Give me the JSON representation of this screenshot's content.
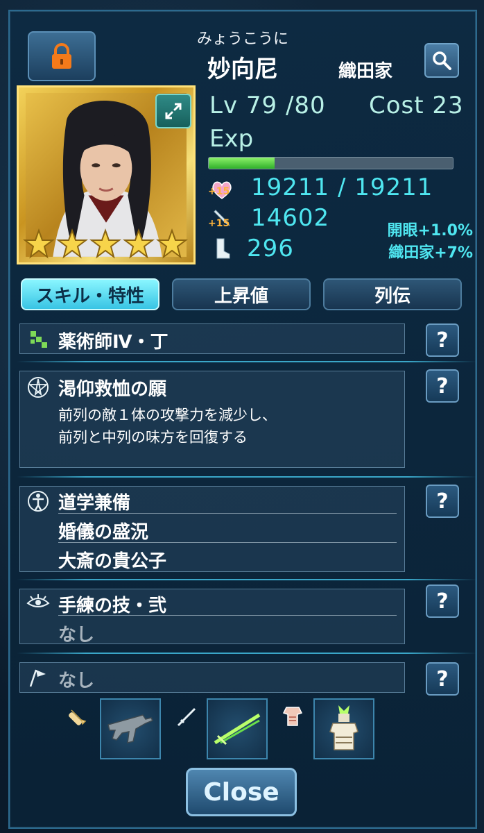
{
  "header": {
    "reading": "みょうこうに",
    "name": "妙向尼",
    "clan": "織田家"
  },
  "stats": {
    "level_text": "Lv 79 /80",
    "cost_text": "Cost 23",
    "exp_label": "Exp",
    "exp_progress": 0.27,
    "hp_bonus": "+15",
    "hp_text": "19211 / 19211",
    "atk_bonus": "+15",
    "atk_text": "14602",
    "spd_text": "296",
    "bonus_awaken": "開眼+1.0%",
    "bonus_clan": "織田家+7%"
  },
  "rarity_stars": 5,
  "tabs": [
    {
      "label": "スキル・特性",
      "active": true
    },
    {
      "label": "上昇値",
      "active": false
    },
    {
      "label": "列伝",
      "active": false
    }
  ],
  "skills": {
    "job": {
      "title": "薬術師Ⅳ・丁"
    },
    "active": {
      "title": "渇仰救恤の願",
      "desc_line1": "前列の敵１体の攻撃力を減少し、",
      "desc_line2": "前列と中列の味方を回復する"
    },
    "traits": [
      "道学兼備",
      "婚儀の盛況",
      "大斎の貴公子"
    ],
    "awaken": {
      "title": "手練の技・弐",
      "sub": "なし"
    },
    "flag": {
      "title": "なし"
    }
  },
  "help_label": "?",
  "close_label": "Close",
  "colors": {
    "accent_cyan": "#4fe6f0",
    "stat_text": "#b8f0e6",
    "exp_green": "#2fb02a",
    "bonus_orange": "#ffb43a"
  }
}
